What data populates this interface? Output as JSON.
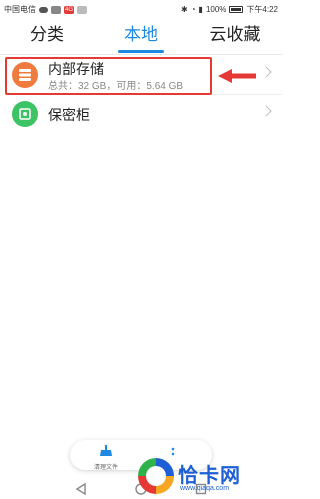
{
  "status_bar": {
    "carrier": "中国电信",
    "network_badge": "4G",
    "battery": "100%",
    "time": "下午4:22"
  },
  "tabs": [
    {
      "label": "分类",
      "active": false
    },
    {
      "label": "本地",
      "active": true
    },
    {
      "label": "云收藏",
      "active": false
    }
  ],
  "items": [
    {
      "title": "内部存储",
      "subtitle": "总共：32 GB，可用：5.64 GB",
      "icon": "storage-icon",
      "icon_color": "#f07b3f"
    },
    {
      "title": "保密柜",
      "icon": "safe-icon",
      "icon_color": "#3cc464"
    }
  ],
  "floating_bar": {
    "clean_label": "清理文件"
  },
  "watermark": {
    "text": "恰卡网",
    "url": "www.qiaqa.com"
  },
  "colors": {
    "accent": "#1e88e5",
    "annotation": "#e53935"
  }
}
